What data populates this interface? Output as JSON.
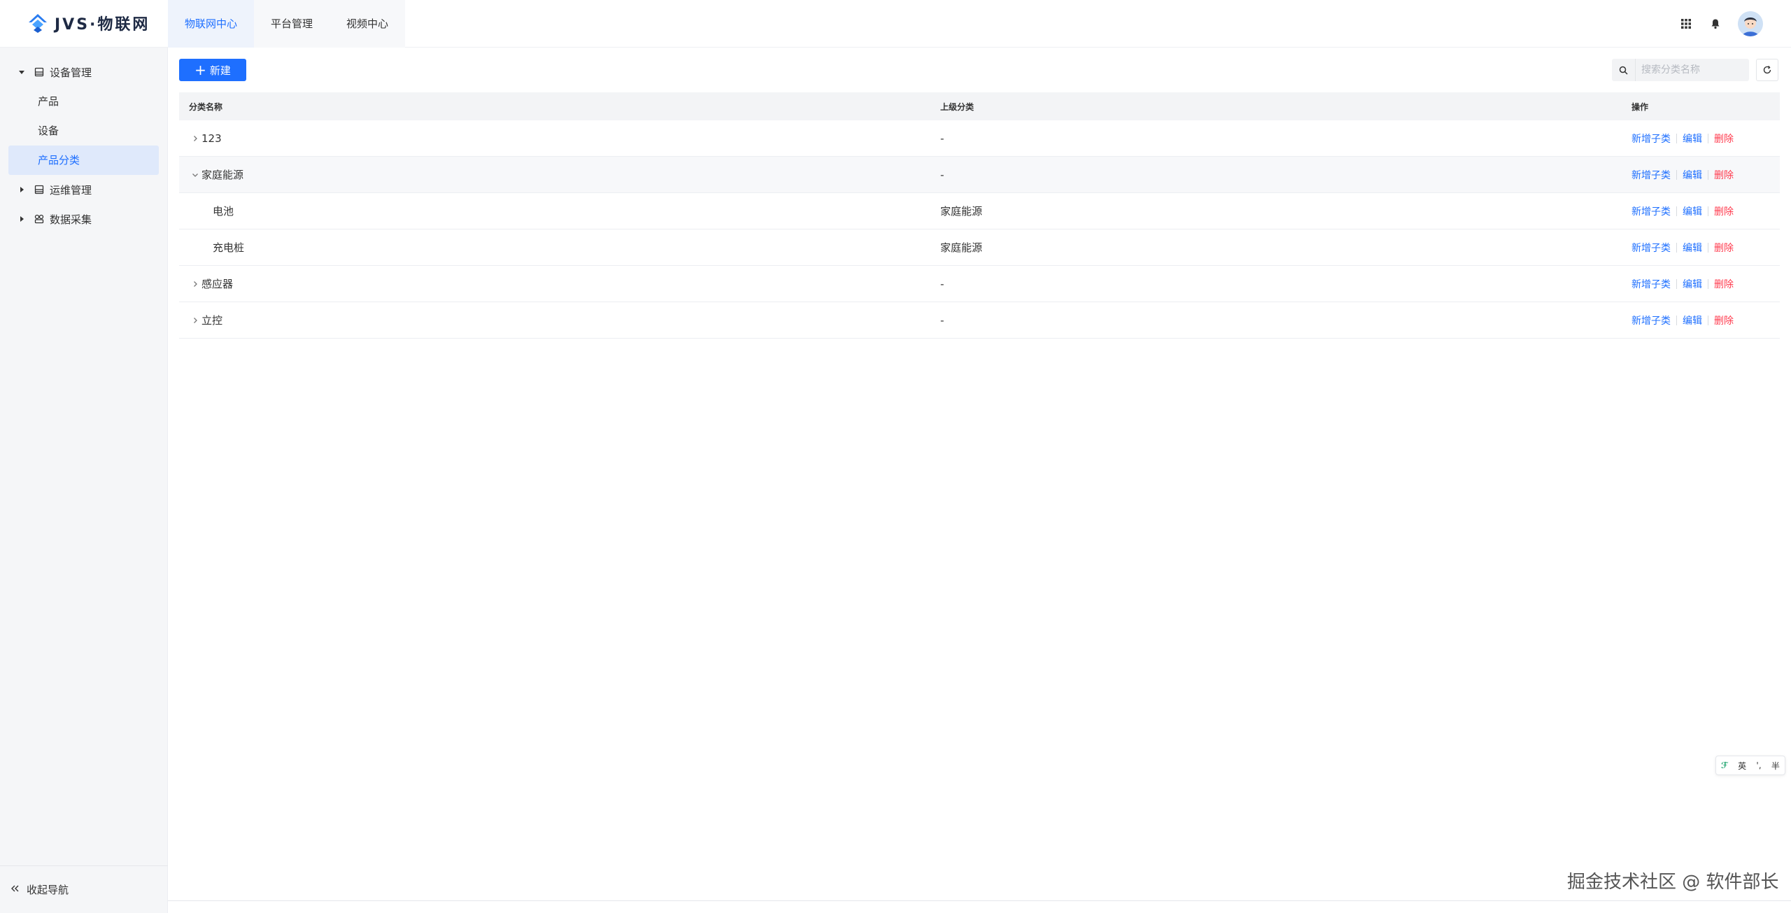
{
  "app": {
    "logo_text": "JVS·物联网"
  },
  "top_tabs": [
    {
      "label": "物联网中心",
      "active": true
    },
    {
      "label": "平台管理",
      "active": false
    },
    {
      "label": "视频中心",
      "active": false
    }
  ],
  "header_icons": [
    "apps-grid-icon",
    "bell-icon",
    "user-avatar"
  ],
  "sidebar": {
    "groups": [
      {
        "label": "设备管理",
        "expanded": true,
        "items": [
          {
            "label": "产品",
            "active": false
          },
          {
            "label": "设备",
            "active": false
          },
          {
            "label": "产品分类",
            "active": true
          }
        ]
      },
      {
        "label": "运维管理",
        "expanded": false
      },
      {
        "label": "数据采集",
        "expanded": false
      }
    ],
    "collapse_label": "收起导航"
  },
  "toolbar": {
    "new_label": "新建",
    "search_placeholder": "搜索分类名称"
  },
  "table": {
    "headers": [
      "分类名称",
      "上级分类",
      "操作"
    ],
    "actions": {
      "add_child": "新增子类",
      "edit": "编辑",
      "delete": "删除"
    },
    "rows": [
      {
        "name": "123",
        "parent": "-",
        "expander": "collapsed",
        "level": 0
      },
      {
        "name": "家庭能源",
        "parent": "-",
        "expander": "expanded",
        "level": 0
      },
      {
        "name": "电池",
        "parent": "家庭能源",
        "expander": "none",
        "level": 1
      },
      {
        "name": "充电桩",
        "parent": "家庭能源",
        "expander": "none",
        "level": 1
      },
      {
        "name": "感应器",
        "parent": "-",
        "expander": "collapsed",
        "level": 0
      },
      {
        "name": "立控",
        "parent": "-",
        "expander": "collapsed",
        "level": 0
      }
    ]
  },
  "ime_bar": {
    "mode": "英",
    "punct": "'‚",
    "width": "半"
  },
  "watermark": "掘金技术社区 @ 软件部长",
  "colors": {
    "primary": "#1e6fff",
    "danger": "#ff3b4e",
    "sidebar_bg": "#f5f6f8",
    "active_bg": "#dfe9fb"
  }
}
